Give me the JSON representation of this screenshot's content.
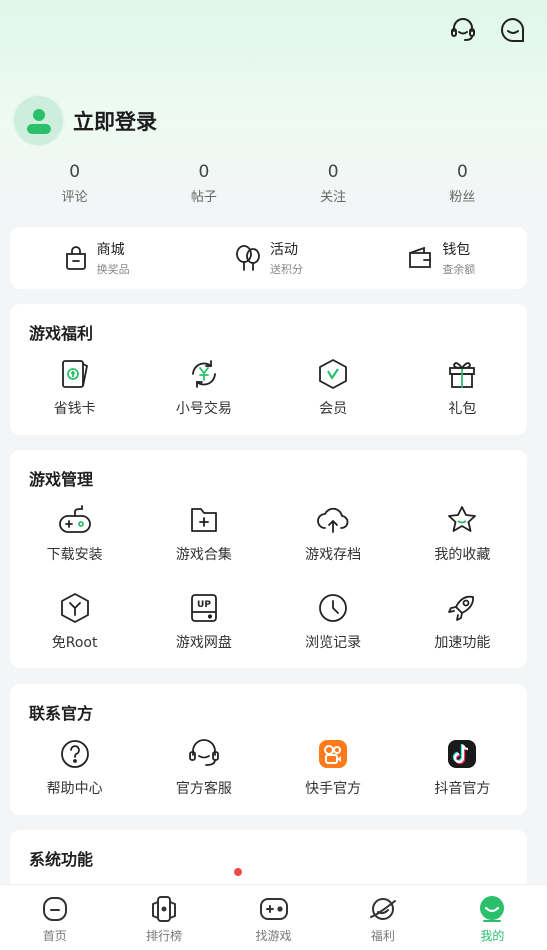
{
  "top_icons": [
    "headset-icon",
    "chat-bubble-icon"
  ],
  "profile": {
    "login_label": "立即登录"
  },
  "stats": [
    {
      "value": "0",
      "label": "评论"
    },
    {
      "value": "0",
      "label": "帖子"
    },
    {
      "value": "0",
      "label": "关注"
    },
    {
      "value": "0",
      "label": "粉丝"
    }
  ],
  "shop": [
    {
      "title": "商城",
      "subtitle": "换奖品",
      "icon": "shopping-bag-icon"
    },
    {
      "title": "活动",
      "subtitle": "送积分",
      "icon": "balloon-icon"
    },
    {
      "title": "钱包",
      "subtitle": "查余额",
      "icon": "wallet-icon"
    }
  ],
  "game_benefits": {
    "title": "游戏福利",
    "items": [
      {
        "label": "省钱卡",
        "icon": "money-card-icon"
      },
      {
        "label": "小号交易",
        "icon": "yen-exchange-icon"
      },
      {
        "label": "会员",
        "icon": "vip-icon"
      },
      {
        "label": "礼包",
        "icon": "gift-icon"
      }
    ]
  },
  "game_manage": {
    "title": "游戏管理",
    "items": [
      {
        "label": "下载安装",
        "icon": "gamepad-icon"
      },
      {
        "label": "游戏合集",
        "icon": "folder-add-icon"
      },
      {
        "label": "游戏存档",
        "icon": "cloud-upload-icon"
      },
      {
        "label": "我的收藏",
        "icon": "star-icon"
      },
      {
        "label": "免Root",
        "icon": "no-root-icon"
      },
      {
        "label": "游戏网盘",
        "icon": "cloud-disk-icon"
      },
      {
        "label": "浏览记录",
        "icon": "clock-icon"
      },
      {
        "label": "加速功能",
        "icon": "rocket-icon"
      }
    ]
  },
  "contact": {
    "title": "联系官方",
    "items": [
      {
        "label": "帮助中心",
        "icon": "help-icon"
      },
      {
        "label": "官方客服",
        "icon": "customer-service-icon"
      },
      {
        "label": "快手官方",
        "icon": "kuaishou-icon"
      },
      {
        "label": "抖音官方",
        "icon": "douyin-icon"
      }
    ]
  },
  "system": {
    "title": "系统功能"
  },
  "up_badge": "UP",
  "tabs": [
    {
      "label": "首页",
      "icon": "home-icon"
    },
    {
      "label": "排行榜",
      "icon": "ranking-icon"
    },
    {
      "label": "找游戏",
      "icon": "find-game-icon"
    },
    {
      "label": "福利",
      "icon": "planet-icon"
    },
    {
      "label": "我的",
      "icon": "mine-icon",
      "active": true
    }
  ],
  "colors": {
    "accent": "#2bbf6c",
    "kuaishou": "#ff7a1a",
    "douyin": "#1a1a1a",
    "badge": "#f24b4b"
  }
}
